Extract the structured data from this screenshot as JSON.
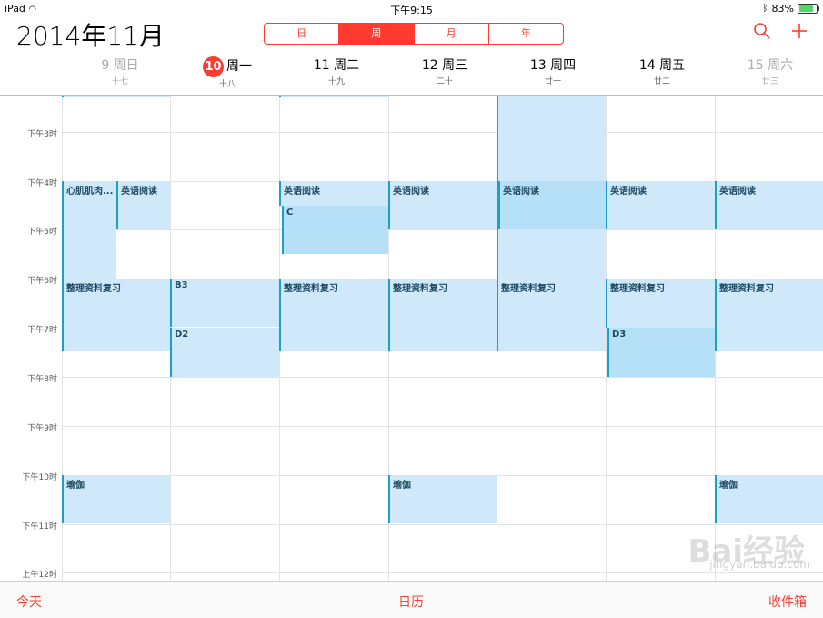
{
  "status": {
    "device": "iPad",
    "time": "下午9:15",
    "battery": "83%"
  },
  "header": {
    "title": "2014年11月",
    "segments": [
      "日",
      "周",
      "月",
      "年"
    ],
    "active_segment": 1
  },
  "days": [
    {
      "date": "9",
      "weekday": "周日",
      "lunar": "十七",
      "dim": true
    },
    {
      "date": "10",
      "weekday": "周一",
      "lunar": "十八",
      "today": true
    },
    {
      "date": "11",
      "weekday": "周二",
      "lunar": "十九"
    },
    {
      "date": "12",
      "weekday": "周三",
      "lunar": "二十"
    },
    {
      "date": "13",
      "weekday": "周四",
      "lunar": "廿一"
    },
    {
      "date": "14",
      "weekday": "周五",
      "lunar": "廿二"
    },
    {
      "date": "15",
      "weekday": "周六",
      "lunar": "廿三",
      "dim": true
    }
  ],
  "time_labels": [
    "下午3时",
    "下午4时",
    "下午5时",
    "下午6时",
    "下午7时",
    "下午8时",
    "下午9时",
    "下午10时",
    "下午11时",
    "上午12时"
  ],
  "events": {
    "sun_heart": "心肌肌肉...",
    "english": "英语阅读",
    "c": "C",
    "review": "整理资料复习",
    "b3": "B3",
    "d2": "D2",
    "d3": "D3",
    "yoga": "瑜伽"
  },
  "bottom": {
    "today": "今天",
    "calendars": "日历",
    "inbox": "收件箱"
  },
  "watermark": {
    "brand": "Bai经验",
    "url": "jingyan.baidu.com"
  },
  "colors": {
    "accent": "#ff3b30",
    "event_bg": "#cfe9fa",
    "event_border": "#1f9ec9"
  }
}
